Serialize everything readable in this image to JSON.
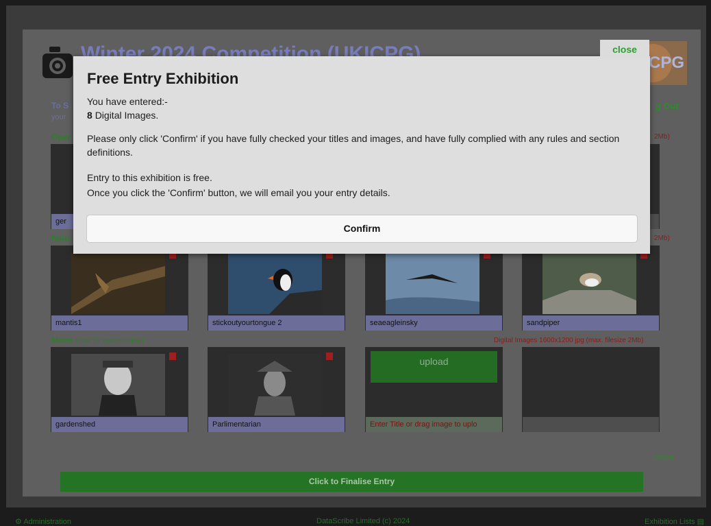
{
  "background": {
    "title": "Winter 2024 Competition (UKICPG)",
    "org_logo_text": "CPG",
    "hint_line1": "To S",
    "hint_line2": "your",
    "logout": "g Out",
    "close_label": "close",
    "more_link": "... more",
    "finalise_label": "Click to Finalise Entry"
  },
  "sections": [
    {
      "name": "Oper",
      "rules": "",
      "spec": "2Mb)"
    },
    {
      "name": "Natu",
      "rules": "",
      "spec": "2Mb)"
    },
    {
      "name": "Mono",
      "rules": "(click for section rules)",
      "spec": "Digital Images 1600x1200 jpg (max. filesize 2Mb)"
    }
  ],
  "open_row_caption": "ger",
  "nature_entries": [
    {
      "title": "mantis1"
    },
    {
      "title": "stickoutyourtongue 2"
    },
    {
      "title": "seaeagleinsky"
    },
    {
      "title": "sandpiper"
    }
  ],
  "mono_entries": [
    {
      "title": "gardenshed"
    },
    {
      "title": "Parlimentarian"
    }
  ],
  "upload_tile": {
    "label": "upload",
    "placeholder": "Enter Title or drag image to uplo"
  },
  "footer": {
    "admin": "Administration",
    "copyright": "DataScribe Limited (c) 2024",
    "lists": "Exhibition Lists"
  },
  "modal": {
    "title": "Free Entry Exhibition",
    "entered_label": "You have entered:-",
    "count": "8",
    "count_unit": "Digital Images.",
    "warning": "Please only click 'Confirm' if you have fully checked your titles and images, and have fully complied with any rules and section definitions.",
    "free_note": "Entry to this exhibition is free.",
    "email_note": "Once you click the 'Confirm' button, we will email you your entry details.",
    "confirm_label": "Confirm"
  }
}
